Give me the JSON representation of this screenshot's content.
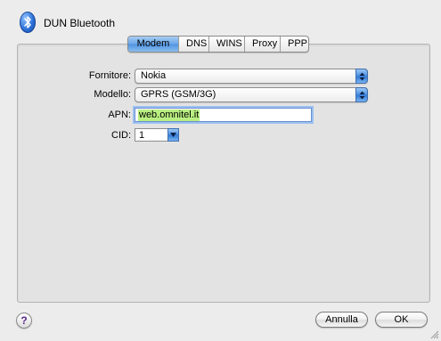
{
  "window": {
    "title": "DUN Bluetooth",
    "icon": "bluetooth-icon"
  },
  "tabs": [
    {
      "label": "Modem",
      "active": true
    },
    {
      "label": "DNS",
      "active": false
    },
    {
      "label": "WINS",
      "active": false
    },
    {
      "label": "Proxy",
      "active": false
    },
    {
      "label": "PPP",
      "active": false
    }
  ],
  "form": {
    "provider": {
      "label": "Fornitore:",
      "value": "Nokia"
    },
    "model": {
      "label": "Modello:",
      "value": "GPRS (GSM/3G)"
    },
    "apn": {
      "label": "APN:",
      "value": "web.omnitel.it"
    },
    "cid": {
      "label": "CID:",
      "value": "1"
    }
  },
  "buttons": {
    "help": "?",
    "cancel": "Annulla",
    "ok": "OK"
  },
  "colors": {
    "accent": "#4f93e0",
    "selection_highlight": "#b9ef80",
    "window_bg": "#ececec"
  }
}
